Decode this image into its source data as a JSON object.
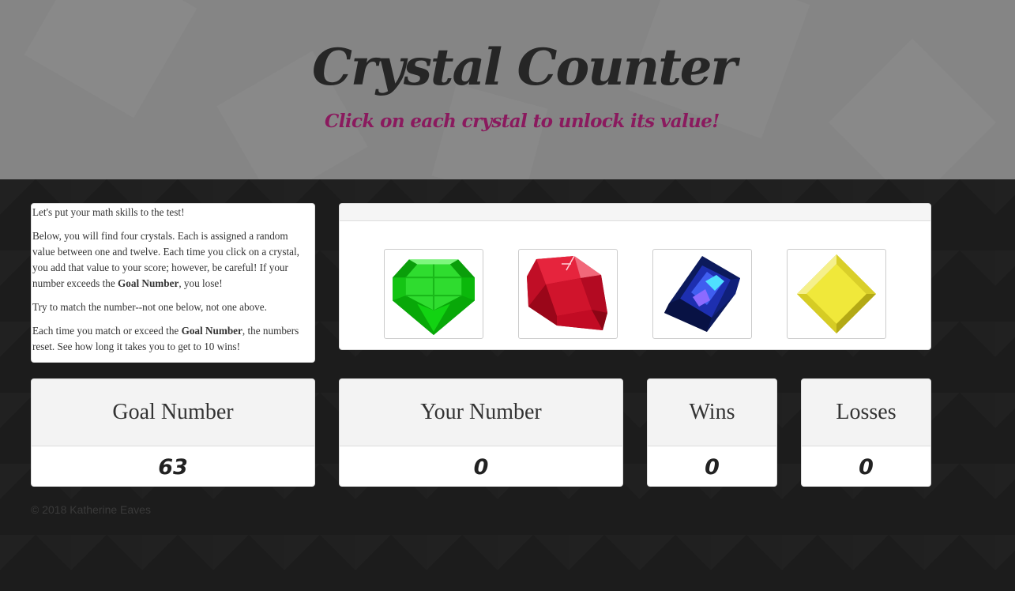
{
  "header": {
    "title": "Crystal Counter",
    "subtitle": "Click on each crystal to unlock its value!"
  },
  "instructions": {
    "p1": "Let's put your math skills to the test!",
    "p2_a": "Below, you will find four crystals. Each is assigned a random value between one and twelve. Each time you click on a crystal, you add that value to your score; however, be careful! If your number exceeds the ",
    "p2_bold": "Goal Number",
    "p2_b": ", you lose!",
    "p3": "Try to match the number--not one below, not one above.",
    "p4_a": "Each time you match or exceed the ",
    "p4_bold": "Goal Number",
    "p4_b": ", the numbers reset. See how long it takes you to get to 10 wins!"
  },
  "crystals": [
    {
      "icon": "green-crystal-icon",
      "color": "#12c412"
    },
    {
      "icon": "red-crystal-icon",
      "color": "#c8102e"
    },
    {
      "icon": "blue-crystal-icon",
      "color": "#1b2fa8"
    },
    {
      "icon": "yellow-crystal-icon",
      "color": "#e8e23a"
    }
  ],
  "stats": {
    "goal": {
      "label": "Goal Number",
      "value": "63"
    },
    "yours": {
      "label": "Your Number",
      "value": "0"
    },
    "wins": {
      "label": "Wins",
      "value": "0"
    },
    "losses": {
      "label": "Losses",
      "value": "0"
    }
  },
  "footer": "© 2018 Katherine Eaves",
  "colors": {
    "header_bg": "#858585",
    "subtitle": "#8a1a5e",
    "page_bg": "#1c1c1c"
  }
}
